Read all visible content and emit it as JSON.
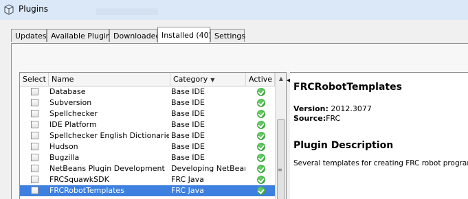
{
  "window": {
    "title": "Plugins"
  },
  "tabs": [
    {
      "label": "Updates"
    },
    {
      "label": "Available Plugins"
    },
    {
      "label": "Downloaded"
    },
    {
      "label": "Installed (40)"
    },
    {
      "label": "Settings"
    }
  ],
  "active_tab": "Installed (40)",
  "table": {
    "headers": {
      "select": "Select",
      "name": "Name",
      "category": "Category",
      "active": "Active"
    },
    "sort_column": "Category",
    "rows": [
      {
        "name": "Database",
        "category": "Base IDE",
        "selected": false
      },
      {
        "name": "Subversion",
        "category": "Base IDE",
        "selected": false
      },
      {
        "name": "Spellchecker",
        "category": "Base IDE",
        "selected": false
      },
      {
        "name": "IDE Platform",
        "category": "Base IDE",
        "selected": false
      },
      {
        "name": "Spellchecker English Dictionaries",
        "category": "Base IDE",
        "selected": false
      },
      {
        "name": "Hudson",
        "category": "Base IDE",
        "selected": false
      },
      {
        "name": "Bugzilla",
        "category": "Base IDE",
        "selected": false
      },
      {
        "name": "NetBeans Plugin Development",
        "category": "Developing NetBeans",
        "selected": false
      },
      {
        "name": "FRCSquawkSDK",
        "category": "FRC Java",
        "selected": false
      },
      {
        "name": "FRCRobotTemplates",
        "category": "FRC Java",
        "selected": true
      }
    ]
  },
  "details": {
    "plugin_name": "FRCRobotTemplates",
    "version_label": "Version:",
    "version_value": "2012.3077",
    "source_label": "Source:",
    "source_value": "FRC",
    "description_heading": "Plugin Description",
    "description": "Several templates for creating FRC robot programs."
  },
  "colors": {
    "selection": "#3d80df",
    "active_icon": "#2ea02e"
  }
}
